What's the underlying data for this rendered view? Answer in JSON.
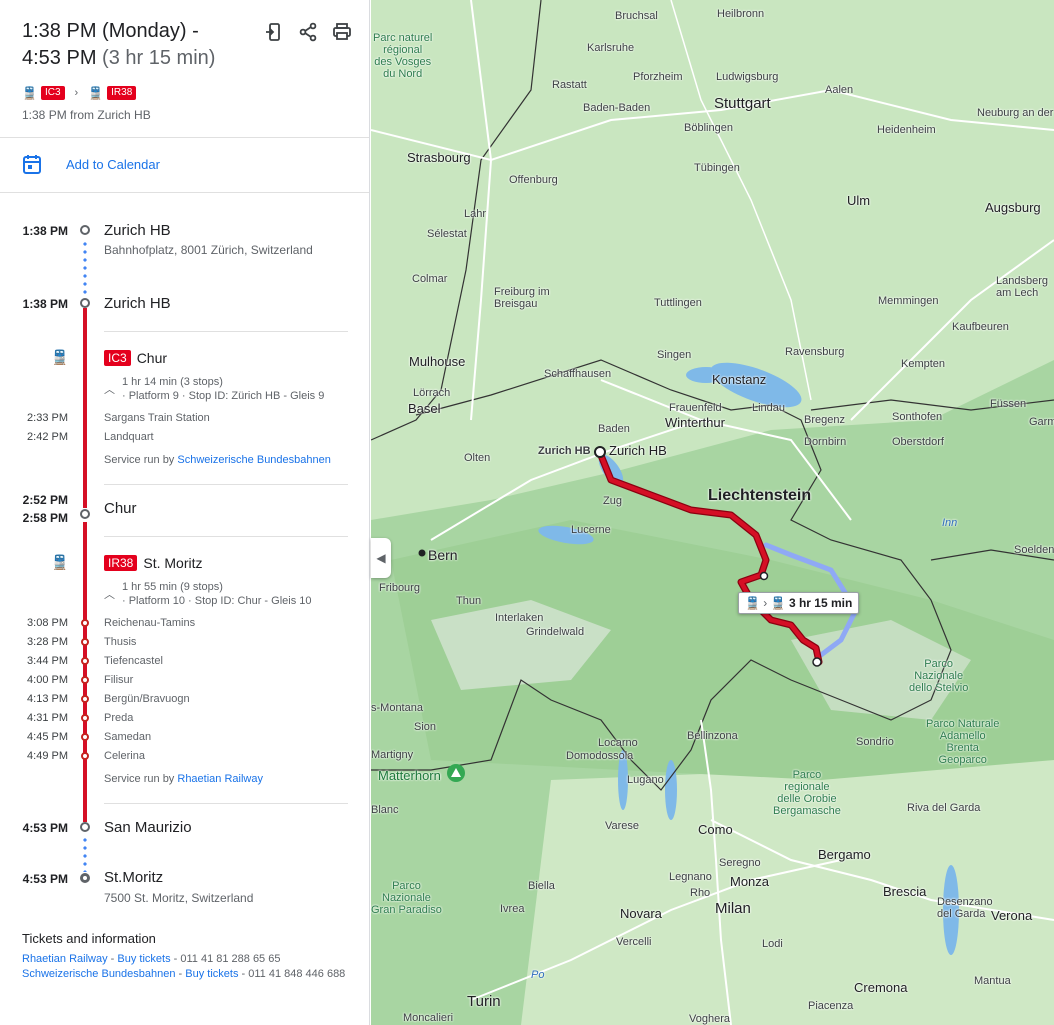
{
  "header": {
    "time_line1": "1:38 PM (Monday) -",
    "time_line2": "4:53 PM",
    "duration": "(3 hr 15 min)",
    "chip1": "IC3",
    "chip2": "IR38",
    "from": "1:38 PM from Zurich HB",
    "icons": [
      "send-to-phone-icon",
      "share-icon",
      "print-icon"
    ]
  },
  "calendar": {
    "label": "Add to Calendar"
  },
  "itinerary": {
    "origin": {
      "time": "1:38 PM",
      "name": "Zurich HB",
      "address": "Bahnhofplatz, 8001 Zürich, Switzerland"
    },
    "board1": {
      "time": "1:38 PM",
      "name": "Zurich HB"
    },
    "leg1": {
      "line": "IC3",
      "headsign": "Chur",
      "summary": "1 hr 14 min (3 stops)",
      "platform": "· Platform 9 · Stop ID: Zürich HB - Gleis 9",
      "stops": [
        {
          "time": "2:33 PM",
          "name": "Sargans Train Station"
        },
        {
          "time": "2:42 PM",
          "name": "Landquart"
        }
      ],
      "service_prefix": "Service run by ",
      "operator": "Schweizerische Bundesbahnen"
    },
    "transfer": {
      "arrive": "2:52 PM",
      "depart": "2:58 PM",
      "name": "Chur"
    },
    "leg2": {
      "line": "IR38",
      "headsign": "St. Moritz",
      "summary": "1 hr 55 min (9 stops)",
      "platform": "· Platform 10 · Stop ID: Chur - Gleis 10",
      "stops": [
        {
          "time": "3:08 PM",
          "name": "Reichenau-Tamins"
        },
        {
          "time": "3:28 PM",
          "name": "Thusis"
        },
        {
          "time": "3:44 PM",
          "name": "Tiefencastel"
        },
        {
          "time": "4:00 PM",
          "name": "Filisur"
        },
        {
          "time": "4:13 PM",
          "name": "Bergün/Bravuogn"
        },
        {
          "time": "4:31 PM",
          "name": "Preda"
        },
        {
          "time": "4:45 PM",
          "name": "Samedan"
        },
        {
          "time": "4:49 PM",
          "name": "Celerina"
        }
      ],
      "service_prefix": "Service run by ",
      "operator": "Rhaetian Railway"
    },
    "alight": {
      "time": "4:53 PM",
      "name": "San Maurizio"
    },
    "destination": {
      "time": "4:53 PM",
      "name": "St.Moritz",
      "address": "7500 St. Moritz, Switzerland"
    }
  },
  "tickets": {
    "title": "Tickets and information",
    "rows": [
      {
        "operator": "Rhaetian Railway",
        "sep": " - ",
        "link": "Buy tickets",
        "phone": " - 011 41 81 288 65 65"
      },
      {
        "operator": "Schweizerische Bundesbahnen",
        "sep": " - ",
        "link": "Buy tickets",
        "phone": " - 011 41 848 446 688"
      }
    ]
  },
  "map": {
    "duration_label": "3 hr 15 min",
    "route_color": "#c5001a",
    "alt_route_color": "#8fa9f5",
    "labels": {
      "bruchsal": "Bruchsal",
      "heilbronn": "Heilbronn",
      "karlsruhe": "Karlsruhe",
      "rastatt": "Rastatt",
      "pforzheim": "Pforzheim",
      "ludwigsburg": "Ludwigsburg",
      "stuttgart": "Stuttgart",
      "aalen": "Aalen",
      "baden_baden": "Baden-Baden",
      "boblingen": "Böblingen",
      "heidenheim": "Heidenheim",
      "neuburg": "Neuburg an der Donau",
      "strasbourg": "Strasbourg",
      "tubingen": "Tübingen",
      "offenburg": "Offenburg",
      "ulm": "Ulm",
      "augsburg": "Augsburg",
      "lahr": "Lahr",
      "selestat": "Sélestat",
      "colmar": "Colmar",
      "freiburg": "Freiburg im\nBreisgau",
      "landsberg": "Landsberg\nam Lech",
      "tuttlingen": "Tuttlingen",
      "memmingen": "Memmingen",
      "kaufbeuren": "Kaufbeuren",
      "mulhouse": "Mulhouse",
      "singen": "Singen",
      "ravensburg": "Ravensburg",
      "kempten": "Kempten",
      "schaffhausen": "Schaffhausen",
      "konstanz": "Konstanz",
      "lorrach": "Lörrach",
      "basel": "Basel",
      "frauenfeld": "Frauenfeld",
      "lindau": "Lindau",
      "sonthofen": "Sonthofen",
      "fussen": "Füssen",
      "winterthur": "Winterthur",
      "bregenz": "Bregenz",
      "baden": "Baden",
      "dornbirn": "Dornbirn",
      "oberstdorf": "Oberstdorf",
      "olten": "Olten",
      "zurich_hb_a": "Zurich HB",
      "zurich_hb_b": "Zurich HB",
      "liechtenstein": "Liechtenstein",
      "zug": "Zug",
      "lucerne": "Lucerne",
      "bern": "Bern",
      "soelden": "Soelden",
      "fribourg": "Fribourg",
      "thun": "Thun",
      "interlaken": "Interlaken",
      "grindelwald": "Grindelwald",
      "sion": "Sion",
      "bellinzona": "Bellinzona",
      "locarno": "Locarno",
      "domodossola": "Domodossola",
      "lugano": "Lugano",
      "sondrio": "Sondrio",
      "matterhorn": "Matterhorn",
      "varese": "Varese",
      "como": "Como",
      "bergamo": "Bergamo",
      "brescia": "Brescia",
      "monza": "Monza",
      "biella": "Biella",
      "novara": "Novara",
      "milan": "Milan",
      "vercelli": "Vercelli",
      "lodi": "Lodi",
      "turin": "Turin",
      "cremona": "Cremona",
      "piacenza": "Piacenza",
      "mantua": "Mantua",
      "verona": "Verona",
      "riva": "Riva del Garda",
      "desenzano": "Desenzano\ndel Garda",
      "seregno": "Seregno",
      "legnano": "Legnano",
      "rho": "Rho",
      "ivrea": "Ivrea",
      "po": "Po",
      "voghera": "Voghera",
      "moncalieri": "Moncalieri",
      "bormio_gar": "Garm",
      "martigny": "Martigny",
      "blanc": "Blanc",
      "montana": "s-Montana",
      "inn": "Inn",
      "parc_vosges": "Parc naturel\nrégional\ndes Vosges\ndu Nord",
      "parc_stelvio": "Parco\nNazionale\ndello Stelvio",
      "parc_adamello": "Parco Naturale\nAdamello\nBrenta\nGeoparco",
      "parc_orobie": "Parco\nregionale\ndelle Orobie\nBergamasche",
      "parc_paradiso": "Parco\nNazionale\nGran Paradiso"
    }
  }
}
